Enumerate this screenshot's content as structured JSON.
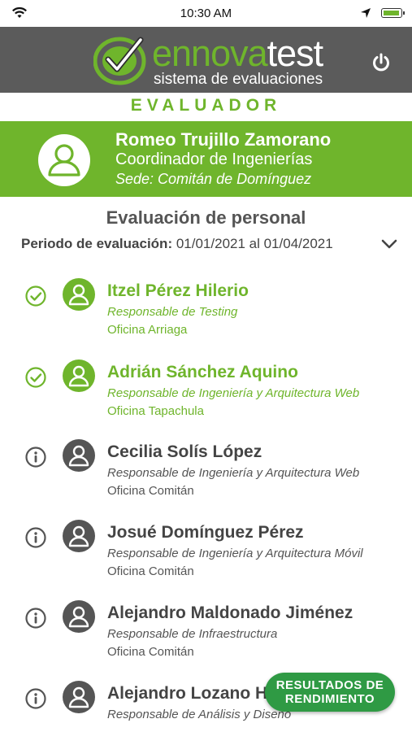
{
  "status_bar": {
    "time": "10:30 AM"
  },
  "header": {
    "logo_word_1": "ennova",
    "logo_word_2": "test",
    "logo_tagline": "sistema de evaluaciones"
  },
  "role_label": "EVALUADOR",
  "user": {
    "name": "Romeo Trujillo Zamorano",
    "title": "Coordinador de Ingenierías",
    "site": "Sede: Comitán de Domínguez"
  },
  "section": {
    "title": "Evaluación de personal",
    "period_label": "Periodo de evaluación:",
    "period_value": "01/01/2021 al 01/04/2021"
  },
  "employees": [
    {
      "name": "Itzel Pérez Hilerio",
      "role": "Responsable de Testing",
      "office": "Oficina Arriaga",
      "status": "done"
    },
    {
      "name": "Adrián Sánchez Aquino",
      "role": "Responsable de Ingeniería y Arquitectura Web",
      "office": "Oficina Tapachula",
      "status": "done"
    },
    {
      "name": "Cecilia Solís López",
      "role": "Responsable de Ingeniería y Arquitectura Web",
      "office": "Oficina Comitán",
      "status": "pending"
    },
    {
      "name": "Josué Domínguez Pérez",
      "role": "Responsable de Ingeniería y Arquitectura Móvil",
      "office": "Oficina Comitán",
      "status": "pending"
    },
    {
      "name": "Alejandro Maldonado Jiménez",
      "role": "Responsable de Infraestructura",
      "office": "Oficina Comitán",
      "status": "pending"
    },
    {
      "name": "Alejandro Lozano Hi",
      "role": "Responsable de Análisis y Diseño",
      "office": "",
      "status": "pending"
    }
  ],
  "results_button": {
    "line1": "RESULTADOS DE",
    "line2": "RENDIMIENTO"
  },
  "colors": {
    "brand_green": "#6fb52c",
    "header_gray": "#5b5b5b",
    "button_green": "#2f9a44"
  },
  "icons": {
    "status_done": "check-circle-icon",
    "status_pending": "info-circle-icon",
    "power": "power-icon",
    "period_toggle": "chevron-down-icon"
  }
}
